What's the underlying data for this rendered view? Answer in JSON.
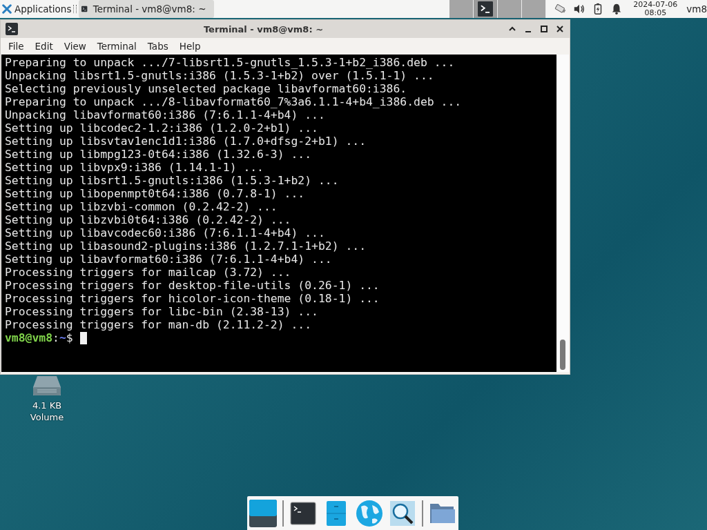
{
  "panel": {
    "apps_label": "Applications",
    "tasks": [
      {
        "title": "Terminal - vm8@vm8: ~",
        "selected": true
      }
    ],
    "workspaces": [
      {
        "selected": false
      },
      {
        "selected": true
      },
      {
        "selected": false
      },
      {
        "selected": false
      }
    ],
    "clock": {
      "date": "2024-07-06",
      "time": "08:05"
    },
    "user": "vm8"
  },
  "window": {
    "title": "Terminal - vm8@vm8: ~",
    "menu": [
      "File",
      "Edit",
      "View",
      "Terminal",
      "Tabs",
      "Help"
    ],
    "lines": [
      "Preparing to unpack .../7-libsrt1.5-gnutls_1.5.3-1+b2_i386.deb ...",
      "Unpacking libsrt1.5-gnutls:i386 (1.5.3-1+b2) over (1.5.1-1) ...",
      "Selecting previously unselected package libavformat60:i386.",
      "Preparing to unpack .../8-libavformat60_7%3a6.1.1-4+b4_i386.deb ...",
      "Unpacking libavformat60:i386 (7:6.1.1-4+b4) ...",
      "Setting up libcodec2-1.2:i386 (1.2.0-2+b1) ...",
      "Setting up libsvtav1enc1d1:i386 (1.7.0+dfsg-2+b1) ...",
      "Setting up libmpg123-0t64:i386 (1.32.6-3) ...",
      "Setting up libvpx9:i386 (1.14.1-1) ...",
      "Setting up libsrt1.5-gnutls:i386 (1.5.3-1+b2) ...",
      "Setting up libopenmpt0t64:i386 (0.7.8-1) ...",
      "Setting up libzvbi-common (0.2.42-2) ...",
      "Setting up libzvbi0t64:i386 (0.2.42-2) ...",
      "Setting up libavcodec60:i386 (7:6.1.1-4+b4) ...",
      "Setting up libasound2-plugins:i386 (1.2.7.1-1+b2) ...",
      "Setting up libavformat60:i386 (7:6.1.1-4+b4) ...",
      "Processing triggers for mailcap (3.72) ...",
      "Processing triggers for desktop-file-utils (0.26-1) ...",
      "Processing triggers for hicolor-icon-theme (0.18-1) ...",
      "Processing triggers for libc-bin (2.38-13) ...",
      "Processing triggers for man-db (2.11.2-2) ..."
    ],
    "prompt": {
      "user": "vm8@vm8",
      "separator": ":",
      "path": "~",
      "symbol": "$"
    }
  },
  "desktop_icons": [
    {
      "label": "4.1 KB Volume"
    }
  ],
  "dock": [
    {
      "kind": "desktop"
    },
    {
      "kind": "separator"
    },
    {
      "kind": "terminal"
    },
    {
      "kind": "files-cabinet"
    },
    {
      "kind": "globe"
    },
    {
      "kind": "search"
    },
    {
      "kind": "separator"
    },
    {
      "kind": "folder"
    }
  ]
}
